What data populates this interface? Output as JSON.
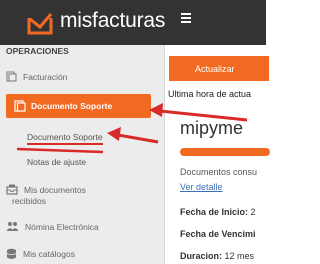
{
  "header": {
    "brand": "misfacturas",
    "logo_icon": "envelope-check-icon",
    "menu_icon": "menu-icon",
    "bg_color": "#333333"
  },
  "sidebar": {
    "section_title": "OPERACIONES",
    "items": [
      {
        "label": "Facturación",
        "icon": "invoice-icon"
      },
      {
        "label": "Documento Soporte",
        "icon": "document-icon",
        "active": true
      },
      {
        "label": "Mis documentos",
        "icon": "inbox-icon"
      },
      {
        "label": "recibidos"
      },
      {
        "label": "Nómina Electrónica",
        "icon": "users-icon"
      },
      {
        "label": "Mis catálogos",
        "icon": "database-icon"
      }
    ],
    "subitems": [
      {
        "label": "Documento Soporte",
        "active": true
      },
      {
        "label": "Notas de ajuste"
      }
    ],
    "active_color": "#f26a21"
  },
  "main": {
    "update_button": "Actualizar",
    "last_update_label": "Ultima hora de actua",
    "plan_name": "mipyme",
    "progress_fraction": 1.0,
    "documents_label": "Documentos consu",
    "view_detail": "Ver detalle",
    "start_date_label": "Fecha de Inicio:",
    "start_date_value": "2",
    "end_date_label": "Fecha de Vencimi",
    "duration_label": "Duracion:",
    "duration_value": "12 mes"
  },
  "annotation_color": "#d92a2a"
}
